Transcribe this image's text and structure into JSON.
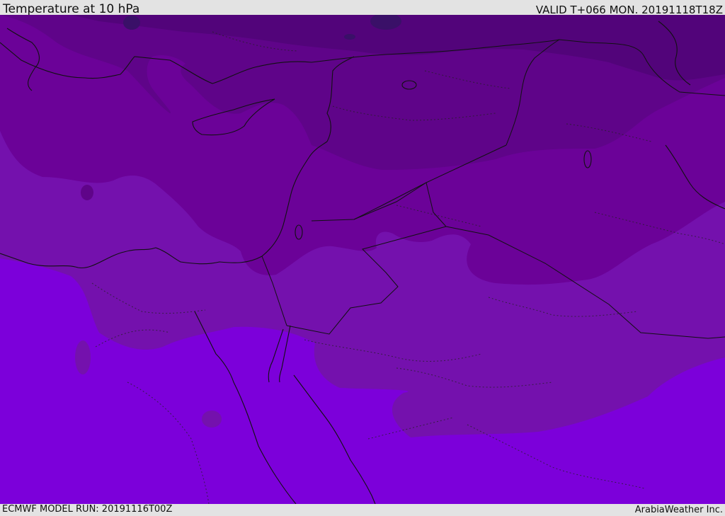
{
  "header": {
    "title": "Temperature at 10 hPa",
    "valid": "VALID T+066 MON. 20191118T18Z"
  },
  "footer": {
    "model_run": "ECMWF MODEL RUN: 20191116T00Z",
    "credit": "ArabiaWeather Inc."
  },
  "map": {
    "region": "Eastern Mediterranean and Middle East",
    "field": "temperature",
    "level": "10 hPa",
    "colors": {
      "coldest_spot": "#3a1068",
      "band_darkest": "#52047a",
      "band_dark": "#5f0489",
      "band_mid": "#6b0298",
      "band_light": "#7411ad",
      "band_lightest": "#7c00da",
      "coastline": "#111111",
      "border": "#111111"
    }
  }
}
